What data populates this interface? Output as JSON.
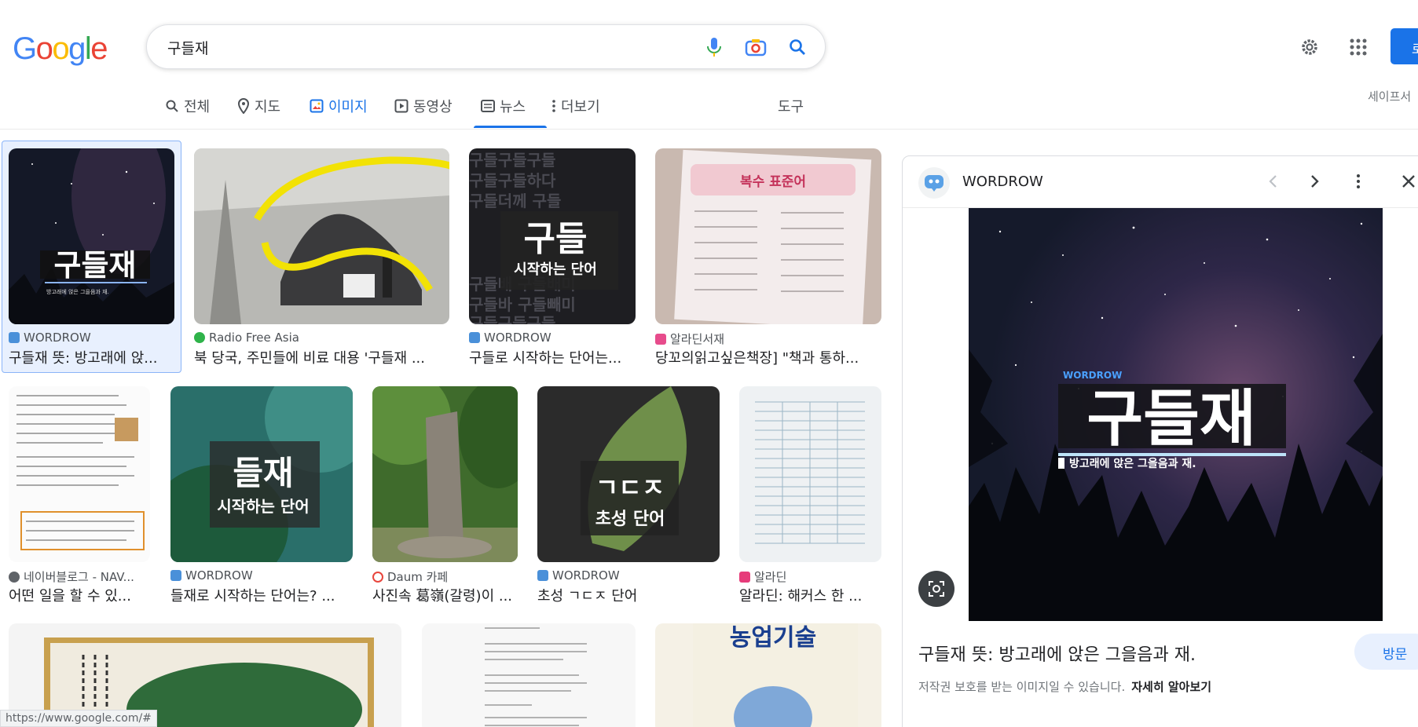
{
  "logo": "Google",
  "search": {
    "query": "구들재"
  },
  "header": {
    "signin_label": "로"
  },
  "tabs": [
    {
      "label": "전체",
      "icon": "search-icon"
    },
    {
      "label": "지도",
      "icon": "map-pin-icon"
    },
    {
      "label": "이미지",
      "icon": "image-icon",
      "active": true
    },
    {
      "label": "동영상",
      "icon": "play-icon"
    },
    {
      "label": "뉴스",
      "icon": "news-icon"
    },
    {
      "label": "더보기",
      "icon": "more-vert-icon"
    }
  ],
  "tools_label": "도구",
  "safesearch_label": "세이프서",
  "results": [
    {
      "source": "WORDROW",
      "caption": "구들재 뜻: 방고래에 앉...",
      "thumb_text": "구들재",
      "thumb_sub": "방고래에 앉은 그을음과 재."
    },
    {
      "source": "Radio Free Asia",
      "caption": "북 당국, 주민들에 비료 대용 '구들재 ..."
    },
    {
      "source": "WORDROW",
      "caption": "구들로 시작하는 단어는...",
      "thumb_text": "구들",
      "thumb_sub": "시작하는 단어"
    },
    {
      "source": "알라딘서재",
      "caption": "당꼬의읽고싶은책장] \"책과 통하...",
      "thumb_text": "복수 표준어"
    },
    {
      "source": "네이버블로그 - NAV...",
      "caption": "어떤 일을 할 수 있..."
    },
    {
      "source": "WORDROW",
      "caption": "들재로 시작하는 단어는? ...",
      "thumb_text": "들재",
      "thumb_sub": "시작하는 단어"
    },
    {
      "source": "Daum 카페",
      "caption": "사진속 葛嶺(갈령)이 ..."
    },
    {
      "source": "WORDROW",
      "caption": "초성 ㄱㄷㅈ 단어",
      "thumb_text": "ㄱㄷㅈ",
      "thumb_sub": "초성 단어"
    },
    {
      "source": "알라딘",
      "caption": "알라딘: 해커스 한 ..."
    },
    {
      "thumb_text": ""
    },
    {
      "thumb_text": ""
    },
    {
      "thumb_text": "농업기술"
    }
  ],
  "panel": {
    "site": "WORDROW",
    "image_title": "구들재",
    "image_sub": "방고래에 앉은 그을음과 재.",
    "image_brand": "WORDROW",
    "title": "구들재 뜻: 방고래에 앉은 그을음과 재.",
    "visit_label": "방문",
    "copyright": "저작권 보호를 받는 이미지일 수 있습니다.",
    "learn_more": "자세히 알아보기"
  },
  "status_url": "https://www.google.com/#"
}
